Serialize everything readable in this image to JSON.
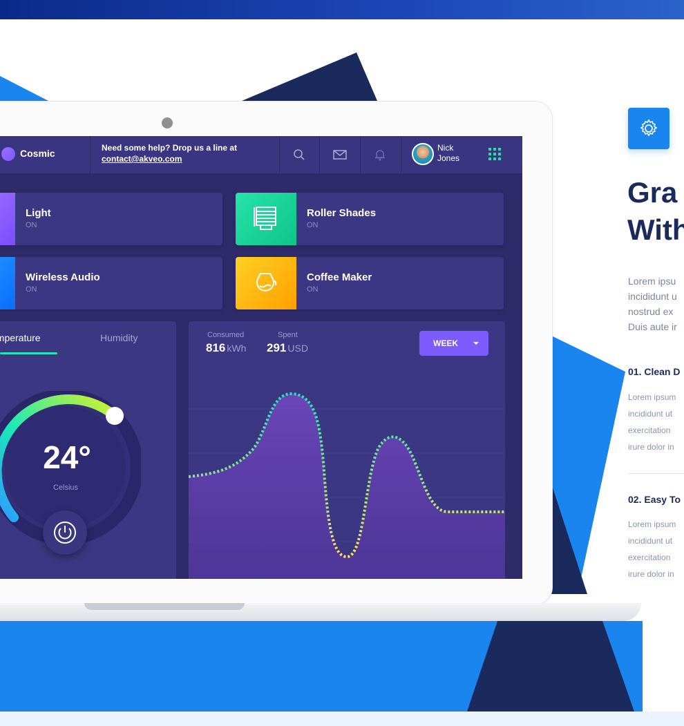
{
  "dashboard": {
    "brand": "Cosmic",
    "help_line1": "Need some help? Drop us a line at",
    "help_email": "contact@akveo.com",
    "user_first": "Nick",
    "user_last": "Jones",
    "devices": [
      {
        "name": "Light",
        "status": "ON",
        "color": "#8e5cff"
      },
      {
        "name": "Roller Shades",
        "status": "ON",
        "color": "#15d69c"
      },
      {
        "name": "Wireless Audio",
        "status": "ON",
        "color": "#1a8cff"
      },
      {
        "name": "Coffee Maker",
        "status": "ON",
        "color": "#ffb300"
      }
    ],
    "tabs": {
      "temperature": "Temperature",
      "humidity": "Humidity"
    },
    "temperature": {
      "value": "24°",
      "unit": "Celsius"
    },
    "stats": {
      "consumed_label": "Consumed",
      "consumed_value": "816",
      "consumed_unit": "kWh",
      "spent_label": "Spent",
      "spent_value": "291",
      "spent_unit": "USD"
    },
    "period_button": "WEEK"
  },
  "feature": {
    "heading_line1": "Gra",
    "heading_line2": "With",
    "lead_lines": [
      "Lorem ipsu",
      "incididunt u",
      "nostrud ex",
      "Duis aute ir"
    ],
    "items": [
      {
        "title": "01. Clean D",
        "body": [
          "Lorem ipsum",
          "incididunt ut",
          "exercitation",
          "irure dolor in"
        ]
      },
      {
        "title": "02. Easy To",
        "body": [
          "Lorem ipsum",
          "incididunt ut",
          "exercitation",
          "irure dolor in"
        ]
      }
    ]
  },
  "colors": {
    "accent": "#1a85ee",
    "navy": "#1b2a5c",
    "dashboard_bg": "#2f2b6b"
  },
  "icons": [
    "search-icon",
    "mail-icon",
    "bell-icon",
    "grid-icon",
    "gear-icon",
    "power-icon",
    "shades-icon",
    "coffee-icon"
  ]
}
